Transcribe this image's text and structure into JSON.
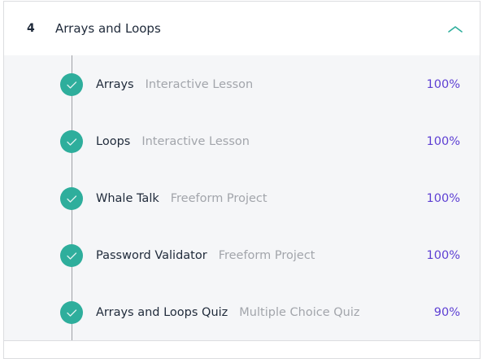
{
  "module": {
    "number": "4",
    "title": "Arrays and Loops",
    "collapse_icon": "chevron-up-icon",
    "accent_color": "#2eae9c",
    "score_color": "#5d3fd3",
    "items": [
      {
        "title": "Arrays",
        "type": "Interactive Lesson",
        "score": "100%"
      },
      {
        "title": "Loops",
        "type": "Interactive Lesson",
        "score": "100%"
      },
      {
        "title": "Whale Talk",
        "type": "Freeform Project",
        "score": "100%"
      },
      {
        "title": "Password Validator",
        "type": "Freeform Project",
        "score": "100%"
      },
      {
        "title": "Arrays and Loops Quiz",
        "type": "Multiple Choice Quiz",
        "score": "90%"
      }
    ]
  }
}
